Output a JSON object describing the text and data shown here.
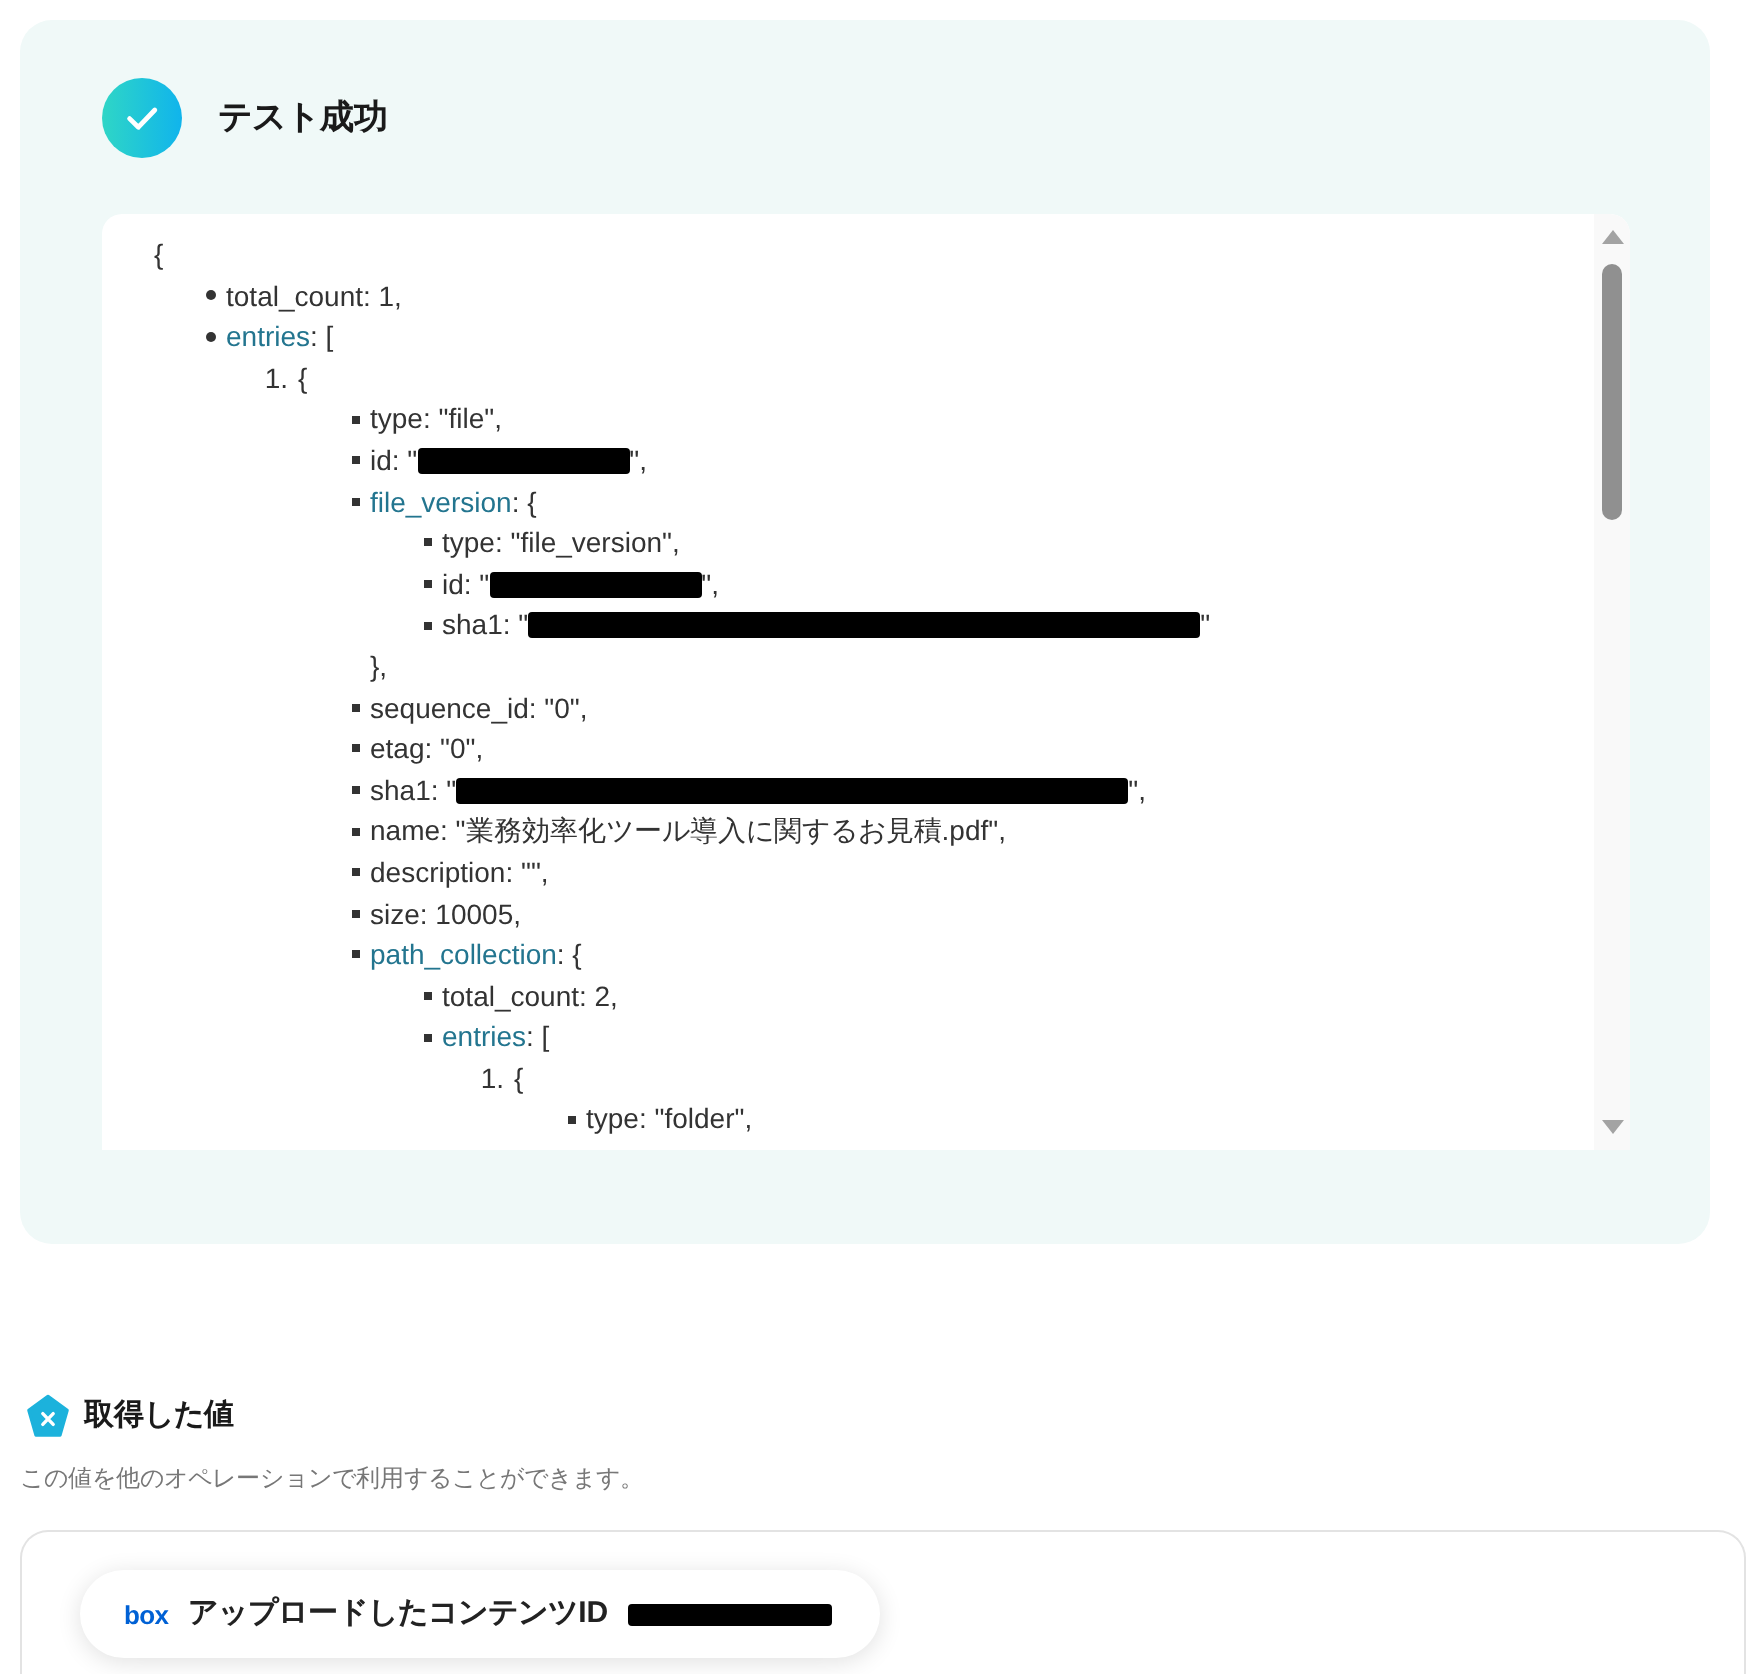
{
  "test_result": {
    "succeeded": true,
    "title": "テスト成功",
    "response": {
      "open": "{",
      "items": [
        {
          "kind": "disc",
          "parts": [
            {
              "kind": "text",
              "text": "total_count: 1,"
            }
          ]
        },
        {
          "kind": "disc",
          "parts": [
            {
              "kind": "key",
              "text": "entries"
            },
            {
              "kind": "text",
              "text": ": ["
            }
          ],
          "children": [
            {
              "kind": "numbered",
              "number": "1.",
              "parts": [
                {
                  "kind": "text",
                  "text": "{"
                }
              ],
              "children": [
                {
                  "kind": "square",
                  "parts": [
                    {
                      "kind": "text",
                      "text": "type: \"file\","
                    }
                  ]
                },
                {
                  "kind": "square",
                  "parts": [
                    {
                      "kind": "text",
                      "text": "id: \""
                    },
                    {
                      "kind": "shortredaction"
                    },
                    {
                      "kind": "text",
                      "text": "\","
                    }
                  ]
                },
                {
                  "kind": "square",
                  "parts": [
                    {
                      "kind": "key",
                      "text": "file_version"
                    },
                    {
                      "kind": "text",
                      "text": ": {"
                    }
                  ],
                  "close": "},",
                  "children": [
                    {
                      "kind": "square",
                      "parts": [
                        {
                          "kind": "text",
                          "text": "type: \"file_version\","
                        }
                      ]
                    },
                    {
                      "kind": "square",
                      "parts": [
                        {
                          "kind": "text",
                          "text": "id: \""
                        },
                        {
                          "kind": "shortredaction"
                        },
                        {
                          "kind": "text",
                          "text": "\","
                        }
                      ]
                    },
                    {
                      "kind": "square",
                      "parts": [
                        {
                          "kind": "text",
                          "text": "sha1: \""
                        },
                        {
                          "kind": "longredaction"
                        },
                        {
                          "kind": "text",
                          "text": "\""
                        }
                      ]
                    }
                  ]
                },
                {
                  "kind": "square",
                  "parts": [
                    {
                      "kind": "text",
                      "text": "sequence_id: \"0\","
                    }
                  ]
                },
                {
                  "kind": "square",
                  "parts": [
                    {
                      "kind": "text",
                      "text": "etag: \"0\","
                    }
                  ]
                },
                {
                  "kind": "square",
                  "parts": [
                    {
                      "kind": "text",
                      "text": "sha1: \""
                    },
                    {
                      "kind": "longredaction"
                    },
                    {
                      "kind": "text",
                      "text": "\","
                    }
                  ]
                },
                {
                  "kind": "square",
                  "parts": [
                    {
                      "kind": "text",
                      "text": "name: \"業務効率化ツール導入に関するお見積.pdf\","
                    }
                  ]
                },
                {
                  "kind": "square",
                  "parts": [
                    {
                      "kind": "text",
                      "text": "description: \"\","
                    }
                  ]
                },
                {
                  "kind": "square",
                  "parts": [
                    {
                      "kind": "text",
                      "text": "size: 10005,"
                    }
                  ]
                },
                {
                  "kind": "square",
                  "parts": [
                    {
                      "kind": "key",
                      "text": "path_collection"
                    },
                    {
                      "kind": "text",
                      "text": ": {"
                    }
                  ],
                  "children": [
                    {
                      "kind": "square",
                      "parts": [
                        {
                          "kind": "text",
                          "text": "total_count: 2,"
                        }
                      ]
                    },
                    {
                      "kind": "square",
                      "parts": [
                        {
                          "kind": "key",
                          "text": "entries"
                        },
                        {
                          "kind": "text",
                          "text": ": ["
                        }
                      ],
                      "children": [
                        {
                          "kind": "numbered",
                          "number": "1.",
                          "parts": [
                            {
                              "kind": "text",
                              "text": "{"
                            }
                          ],
                          "children": [
                            {
                              "kind": "square",
                              "parts": [
                                {
                                  "kind": "text",
                                  "text": "type: \"folder\","
                                }
                              ]
                            }
                          ]
                        }
                      ]
                    }
                  ]
                }
              ]
            }
          ]
        }
      ]
    }
  },
  "output_values": {
    "title": "取得した値",
    "description": "この値を他のオペレーションで利用することができます。",
    "values": [
      {
        "service_logo": "box",
        "label": "アップロードしたコンテンツID",
        "value_redacted": true
      }
    ]
  }
}
